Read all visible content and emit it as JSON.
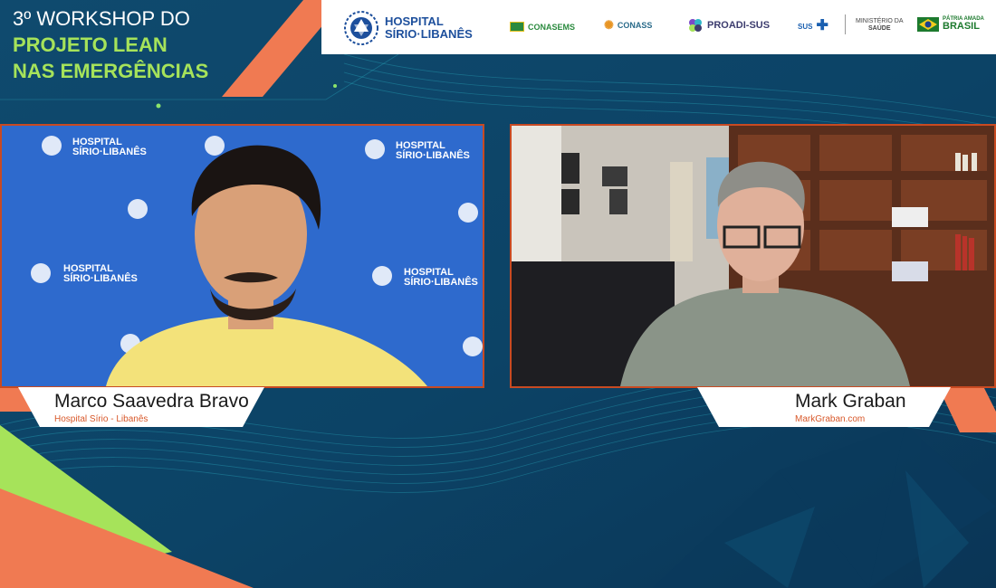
{
  "event": {
    "title_line1": "3º WORKSHOP DO",
    "title_line2": "PROJETO LEAN",
    "title_line3": "NAS EMERGÊNCIAS"
  },
  "logos": {
    "hospital_line1": "HOSPITAL",
    "hospital_line2": "SÍRIO·LIBANÊS",
    "conasems": "CONASEMS",
    "conass": "CONASS",
    "proadi": "PROADI-SUS",
    "sus": "SUS",
    "ministerio_line1": "MINISTÉRIO DA",
    "ministerio_line2": "SAÚDE",
    "brasil_line1": "PÁTRIA AMADA",
    "brasil_line2": "BRASIL"
  },
  "backdrop_text": {
    "line1": "HOSPITAL",
    "line2": "SÍRIO·LIBANÊS"
  },
  "participants": [
    {
      "name": "Marco Saavedra Bravo",
      "affiliation": "Hospital Sírio - Libanês"
    },
    {
      "name": "Mark Graban",
      "affiliation": "MarkGraban.com"
    }
  ],
  "colors": {
    "background": "#0d3a5c",
    "accent_orange": "#f07a52",
    "accent_green": "#a6e35a",
    "border": "#c84a22"
  }
}
